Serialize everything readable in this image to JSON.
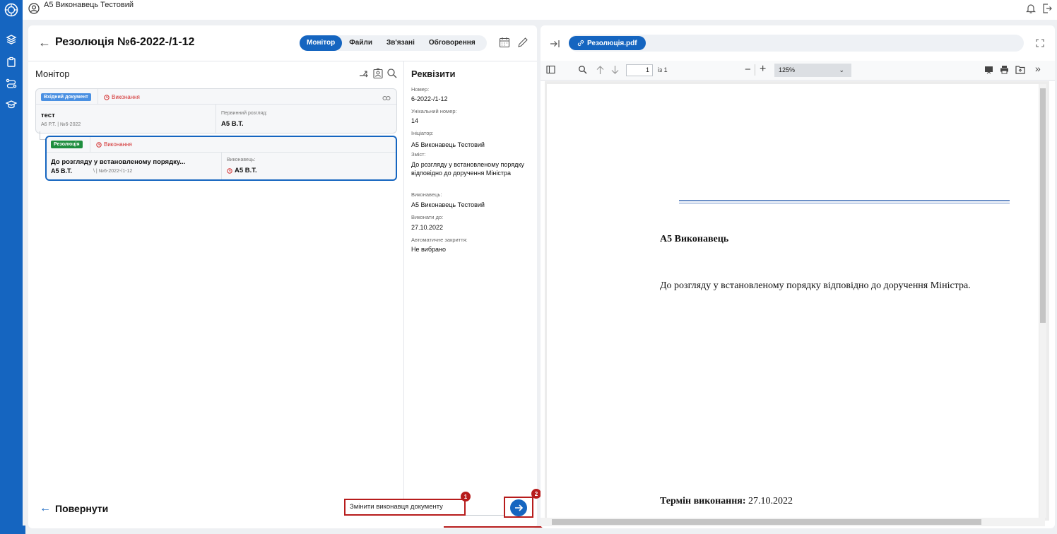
{
  "app": {
    "user_name": "А5 Виконавець Тестовий"
  },
  "document": {
    "title": "Резолюція №6-2022-/1-12",
    "tabs": [
      "Монітор",
      "Файли",
      "Зв'язані",
      "Обговорення"
    ],
    "active_tab": "Монітор"
  },
  "monitor": {
    "heading": "Монітор",
    "parent_card": {
      "type_badge": "Вхідний документ",
      "status": "Виконання",
      "title": "тест",
      "subtitle": "А6 Р.Т. | №6-2022",
      "field_label": "Первинний розгляд:",
      "field_value": "А5 В.Т."
    },
    "child_card": {
      "type_badge": "Резолюція",
      "status": "Виконання",
      "title": "До розгляду у встановленому порядку...",
      "author": "А5 В.Т.",
      "number": "\\ | №6-2022-/1-12",
      "field_label": "Виконавець:",
      "field_value": "А5 В.Т."
    }
  },
  "properties": {
    "heading": "Реквізити",
    "items": [
      {
        "label": "Номер:",
        "value": "6-2022-/1-12"
      },
      {
        "label": "Унікальний номер:",
        "value": "14"
      },
      {
        "label": "Ініціатор:",
        "value": "А5 Виконавець Тестовий"
      },
      {
        "label": "Зміст:",
        "value": "До розгляду у встановленому порядку відповідно до доручення Міністра"
      },
      {
        "label": "Виконавець:",
        "value": "А5 Виконавець Тестовий"
      },
      {
        "label": "Виконати до:",
        "value": "27.10.2022"
      },
      {
        "label": "Автоматичне закриття:",
        "value": "Не вибрано"
      }
    ]
  },
  "footer": {
    "return_label": "Повернути",
    "action_value": "Змінити виконавця документу",
    "marker_1": "1",
    "marker_2": "2"
  },
  "pdf": {
    "file_name": "Резолюція.pdf",
    "page_current": "1",
    "page_total": "із 1",
    "zoom": "125%",
    "name_line": "А5 Виконавець",
    "body_text": "До розгляду у встановленому порядку відповідно до доручення Міністра.",
    "term_label": "Термін виконання:",
    "term_value": "27.10.2022"
  },
  "colors": {
    "brand": "#1565c0",
    "status_red": "#d32f2f",
    "highlight_red": "#b71c1c"
  }
}
